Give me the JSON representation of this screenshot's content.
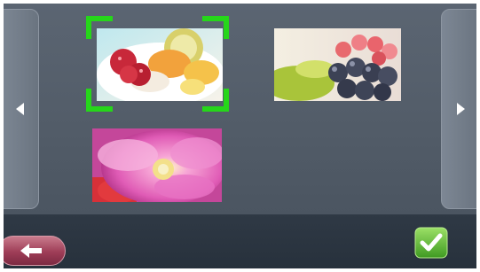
{
  "screen": "photo-gallery",
  "navigation": {
    "prev_icon": "triangle-left-icon",
    "next_icon": "triangle-right-icon"
  },
  "photos": [
    {
      "subject": "fruit",
      "selected": true
    },
    {
      "subject": "grapes",
      "selected": false
    },
    {
      "subject": "flower",
      "selected": false
    }
  ],
  "toolbar": {
    "back_icon": "arrow-left-icon",
    "confirm_icon": "checkmark-icon"
  },
  "colors": {
    "selection": "#26d61a",
    "background": "#56606d",
    "toolbar": "#2b3541",
    "back_button": "#9e3d57",
    "confirm_button": "#5fb334"
  }
}
